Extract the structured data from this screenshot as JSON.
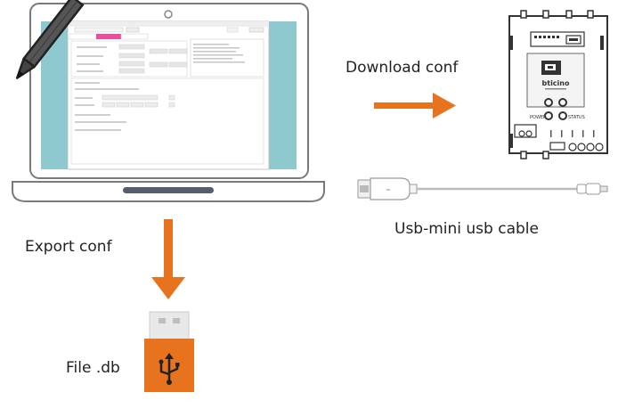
{
  "labels": {
    "download": "Download conf",
    "export": "Export conf",
    "cable": "Usb-mini usb cable",
    "file": "File .db"
  },
  "app_window": {
    "tabs": [
      "Configuration",
      "",
      "Device Settings"
    ]
  },
  "device": {
    "brand": "bticino",
    "power_label": "POWER",
    "status_label": "STATUS"
  },
  "colors": {
    "arrow": "#e8731f",
    "usb_stick": "#e8731f",
    "laptop_outline": "#777777",
    "laptop_screen_bg": "#8ec9cf",
    "app_tab_active": "#e84f9c",
    "pencil_body": "#555555"
  },
  "icons": [
    "pencil-icon",
    "usb-symbol-icon",
    "camera-icon"
  ]
}
